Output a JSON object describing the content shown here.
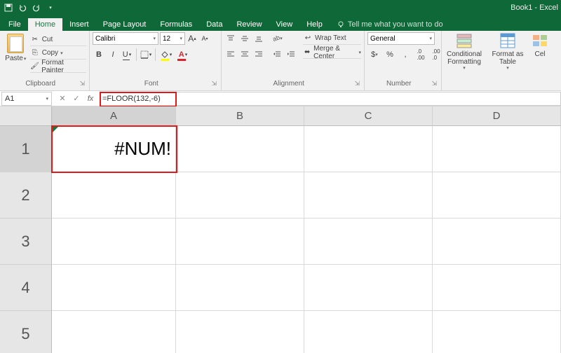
{
  "titlebar": {
    "doc_name": "Book1 - Excel"
  },
  "tabs": {
    "file": "File",
    "items": [
      "Home",
      "Insert",
      "Page Layout",
      "Formulas",
      "Data",
      "Review",
      "View",
      "Help"
    ],
    "active": "Home",
    "tellme": "Tell me what you want to do"
  },
  "ribbon": {
    "clipboard": {
      "label": "Clipboard",
      "paste": "Paste",
      "cut": "Cut",
      "copy": "Copy",
      "format_painter": "Format Painter"
    },
    "font": {
      "label": "Font",
      "name": "Calibri",
      "size": "12",
      "increase": "A",
      "decrease": "A",
      "bold": "B",
      "italic": "I",
      "underline": "U"
    },
    "alignment": {
      "label": "Alignment",
      "wrap": "Wrap Text",
      "merge": "Merge & Center"
    },
    "number": {
      "label": "Number",
      "format": "General",
      "currency": "$",
      "percent": "%",
      "comma": ",",
      "inc_dec": "←.0",
      "dec_dec": ".00→"
    },
    "styles": {
      "conditional": "Conditional Formatting",
      "table": "Format as Table",
      "cell": "Cel"
    }
  },
  "formulabar": {
    "name_box": "A1",
    "formula": "=FLOOR(132,-6)"
  },
  "grid": {
    "columns": [
      "A",
      "B",
      "C",
      "D"
    ],
    "rows": [
      "1",
      "2",
      "3",
      "4",
      "5"
    ],
    "cells": {
      "A1": "#NUM!"
    },
    "selected": "A1"
  }
}
